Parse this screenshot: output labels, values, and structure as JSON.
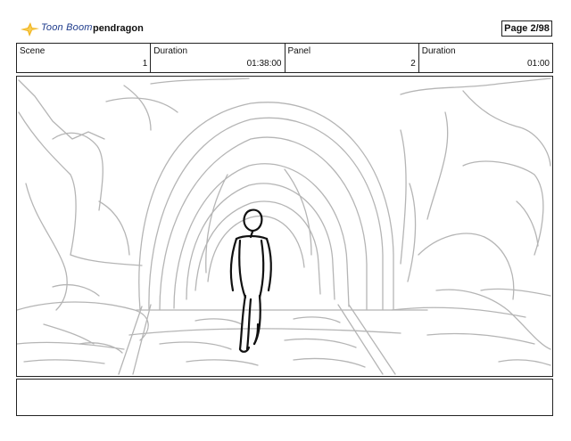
{
  "header": {
    "logo_text": "Toon Boom",
    "project_name": "pendragon",
    "page_label": "Page",
    "page_value": "2/98"
  },
  "info": {
    "scene_label": "Scene",
    "scene_value": "1",
    "scene_duration_label": "Duration",
    "scene_duration_value": "01:38:00",
    "panel_label": "Panel",
    "panel_value": "2",
    "panel_duration_label": "Duration",
    "panel_duration_value": "01:00"
  },
  "notes": {
    "text": ""
  },
  "colors": {
    "logo_blue": "#1f3c8c",
    "logo_gold": "#f2b31c",
    "sketch_gray": "#b5b5b5",
    "figure_black": "#111111"
  }
}
